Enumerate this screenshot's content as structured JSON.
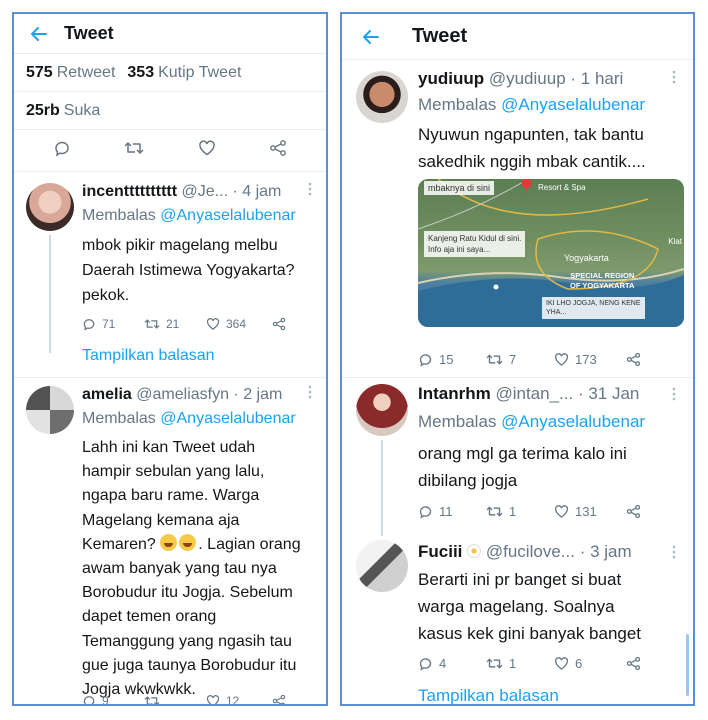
{
  "left": {
    "header": {
      "title": "Tweet"
    },
    "stats": {
      "retweets": "575",
      "retweets_label": "Retweet",
      "quotes": "353",
      "quotes_label": "Kutip Tweet",
      "likes": "25rb",
      "likes_label": "Suka"
    },
    "tweets": [
      {
        "name": "incentttttttttt",
        "handle": "@Je...",
        "time": "· 4 jam",
        "reply_prefix": "Membalas",
        "reply_mention": "@Anyaselalubenar",
        "lines": [
          "mbok pikir magelang melbu",
          "Daerah Istimewa Yogyakarta?",
          "pekok."
        ],
        "replies": "71",
        "retweets": "21",
        "likes": "364",
        "show_replies": "Tampilkan balasan"
      },
      {
        "name": "amelia",
        "handle": "@ameliasfyn",
        "time": "· 2 jam",
        "reply_prefix": "Membalas",
        "reply_mention": "@Anyaselalubenar",
        "lines": [
          "Lahh ini kan Tweet udah",
          "hampir sebulan yang lalu,",
          "ngapa baru rame. Warga",
          "Magelang kemana aja",
          "Kemaren?",
          ". Lagian orang",
          "awam banyak yang tau nya",
          "Borobudur itu Jogja. Sebelum",
          "dapet temen orang",
          "Temanggung yang ngasih tau",
          "gue juga taunya Borobudur itu",
          "Jogja wkwkwkk."
        ],
        "replies": "9",
        "retweets": "",
        "likes": "12"
      }
    ]
  },
  "right": {
    "header": {
      "title": "Tweet"
    },
    "tweets": [
      {
        "name": "yudiuup",
        "handle": "@yudiuup",
        "time": "· 1 hari",
        "reply_prefix": "Membalas",
        "reply_mention": "@Anyaselalubenar",
        "lines": [
          "Nyuwun ngapunten, tak bantu",
          "sakedhik nggih mbak cantik...."
        ],
        "map": {
          "label_top": "mbaknya di sini",
          "label_resort": "Resort & Spa",
          "label_kanjeng": "Kanjeng Ratu Kidul di sini.",
          "label_info": "Info aja ini saya...",
          "label_yogya": "Yogyakarta",
          "label_region_1": "SPECIAL REGION",
          "label_region_2": "OF YOGYAKARTA",
          "label_iki": "IKI LHO JOGJA, NENG KENE",
          "label_yha": "YHA...",
          "label_klat": "Klat"
        },
        "replies": "15",
        "retweets": "7",
        "likes": "173"
      },
      {
        "name": "Intanrhm",
        "handle": "@intan_...",
        "time": "· 31 Jan",
        "reply_prefix": "Membalas",
        "reply_mention": "@Anyaselalubenar",
        "lines": [
          "orang mgl ga terima kalo ini",
          "dibilang jogja"
        ],
        "replies": "11",
        "retweets": "1",
        "likes": "131"
      },
      {
        "name": "Fuciii",
        "handle": "@fucilove...",
        "time": "· 3 jam",
        "lines": [
          "Berarti ini pr banget si buat",
          "warga magelang. Soalnya",
          "kasus kek gini banyak banget"
        ],
        "replies": "4",
        "retweets": "1",
        "likes": "6",
        "show_replies": "Tampilkan balasan"
      }
    ]
  },
  "colors": {
    "accent": "#1da1f2",
    "frame": "#5b8fd0",
    "muted": "#657786"
  },
  "icons": [
    "back-arrow-icon",
    "reply-icon",
    "retweet-icon",
    "like-icon",
    "share-icon",
    "more-icon",
    "flower-icon"
  ]
}
